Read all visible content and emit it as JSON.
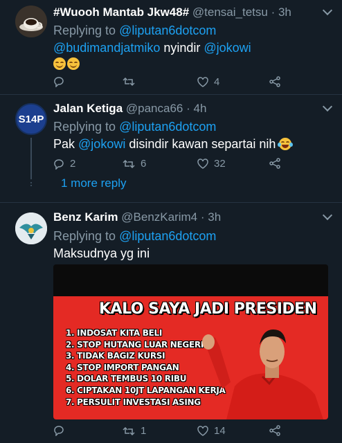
{
  "tweets": [
    {
      "name": "#Wuooh Mantab Jkw48#",
      "handle": "@tensai_tetsu",
      "time": "· 3h",
      "replying_prefix": "Replying to ",
      "replying_to": "@liputan6dotcom",
      "mention": "@budimandjatmiko",
      "text_after": " nyindir ",
      "mention2": "@jokowi",
      "emojis": [
        "smiling-face-emoji",
        "smiling-face-emoji"
      ],
      "replies": "",
      "retweets": "",
      "likes": "4"
    },
    {
      "name": "Jalan Ketiga",
      "handle": "@panca66",
      "time": "· 4h",
      "avatar_text": "S14P",
      "replying_prefix": "Replying to ",
      "replying_to": "@liputan6dotcom",
      "text_before": "Pak ",
      "mention": "@jokowi",
      "text_after": " disindir kawan separtai nih ",
      "emojis": [
        "laughing-tears-emoji"
      ],
      "replies": "2",
      "retweets": "6",
      "likes": "32",
      "more_replies": "1 more reply"
    },
    {
      "name": "Benz Karim",
      "handle": "@BenzKarim4",
      "time": "· 3h",
      "replying_prefix": "Replying to ",
      "replying_to": "@liputan6dotcom",
      "text": "Maksudnya yg ini",
      "replies": "",
      "retweets": "1",
      "likes": "14",
      "media": {
        "title": "KALO SAYA JADI PRESIDEN",
        "items": [
          "1. INDOSAT KITA BELI",
          "2. STOP HUTANG LUAR NEGERI",
          "3. TIDAK BAGIZ KURSI",
          "4. STOP IMPORT PANGAN",
          "5. DOLAR TEMBUS 10 RIBU",
          "6. CIPTAKAN 10JT LAPANGAN KERJA",
          "7. PERSULIT INVESTASI ASING"
        ]
      }
    }
  ],
  "colors": {
    "background": "#141d26",
    "link": "#1da1f2",
    "muted": "#8899a6",
    "poster_red": "#e42a24"
  }
}
